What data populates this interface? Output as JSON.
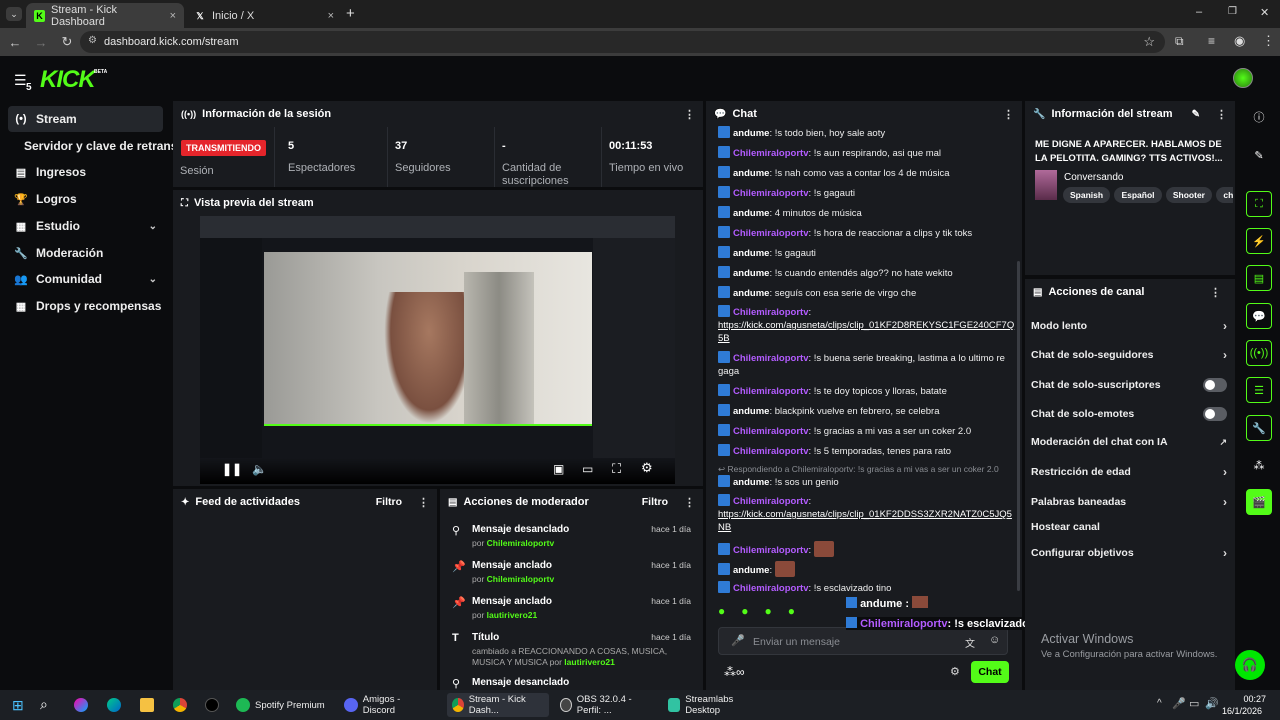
{
  "browser": {
    "tabs": [
      {
        "label": "Stream - Kick Dashboard",
        "close": "×"
      },
      {
        "label": "Inicio / X",
        "close": "×"
      }
    ],
    "new_tab": "+",
    "url": "dashboard.kick.com/stream",
    "window_controls": [
      "–",
      "❐",
      "✕"
    ]
  },
  "header": {
    "logo": "KICK",
    "logo_badge": "BETA",
    "count": "5"
  },
  "sidebar": {
    "items": [
      {
        "label": "Stream",
        "icon": "(•)"
      },
      {
        "label": "Servidor y clave de retransm"
      },
      {
        "label": "Ingresos",
        "icon": "▤"
      },
      {
        "label": "Logros",
        "icon": "🏆"
      },
      {
        "label": "Estudio",
        "icon": "▦",
        "chevron": "⌄"
      },
      {
        "label": "Moderación",
        "icon": "🔧"
      },
      {
        "label": "Comunidad",
        "icon": "👥",
        "chevron": "⌄"
      },
      {
        "label": "Drops y recompensas",
        "icon": "▦"
      }
    ]
  },
  "session": {
    "title": "Información de la sesión",
    "live_badge": "TRANSMITIENDO",
    "session_label": "Sesión",
    "stats": [
      {
        "value": "5",
        "label": "Espectadores"
      },
      {
        "value": "37",
        "label": "Seguidores"
      },
      {
        "value": "-",
        "label": "Cantidad de suscripciones"
      },
      {
        "value": "00:11:53",
        "label": "Tiempo en vivo"
      }
    ]
  },
  "preview": {
    "title": "Vista previa del stream"
  },
  "activity": {
    "title": "Feed de actividades",
    "filter": "Filtro"
  },
  "mod_actions": {
    "title": "Acciones de moderador",
    "filter": "Filtro",
    "rows": [
      {
        "title": "Mensaje desanclado",
        "by": "por",
        "user": "Chilemiraloportv",
        "time": "hace 1 día"
      },
      {
        "title": "Mensaje anclado",
        "by": "por",
        "user": "Chilemiraloportv",
        "time": "hace 1 día"
      },
      {
        "title": "Mensaje anclado",
        "by": "por",
        "user": "lautirivero21",
        "time": "hace 1 día"
      },
      {
        "title": "Título",
        "sub": "cambiado a REACCIONANDO A COSAS, MUSICA, MUSICA Y MUSICA por",
        "user": "lautirivero21",
        "time": "hace 1 día"
      },
      {
        "title": "Mensaje desanclado",
        "by": "",
        "user": "",
        "time": ""
      }
    ]
  },
  "chat": {
    "title": "Chat",
    "messages": [
      {
        "user": "andume",
        "text": "!s todo bien, hoy sale aoty",
        "c": "u1"
      },
      {
        "user": "Chilemiraloportv",
        "text": "!s aun respirando, asi que mal",
        "c": "u2"
      },
      {
        "user": "andume",
        "text": "!s nah como vas a contar los 4 de música",
        "c": "u1"
      },
      {
        "user": "Chilemiraloportv",
        "text": "!s gagauti",
        "c": "u2"
      },
      {
        "user": "andume",
        "text": "4 minutos de música",
        "c": "u1"
      },
      {
        "user": "Chilemiraloportv",
        "text": "!s hora de reaccionar a clips y tik toks",
        "c": "u2"
      },
      {
        "user": "andume",
        "text": "!s gagauti",
        "c": "u1"
      },
      {
        "user": "andume",
        "text": "!s cuando entendés algo?? no hate wekito",
        "c": "u1"
      },
      {
        "user": "andume",
        "text": "seguís con esa serie de virgo che",
        "c": "u1"
      },
      {
        "user": "Chilemiraloportv",
        "text": "",
        "link": "https://kick.com/agusneta/clips/clip_01KF2D8REKYSC1FGE240CF7Q5B",
        "c": "u2"
      },
      {
        "user": "Chilemiraloportv",
        "text": "!s buena serie breaking, lastima a lo ultimo re gaga",
        "c": "u2"
      },
      {
        "user": "Chilemiraloportv",
        "text": "!s te doy topicos y lloras, batate",
        "c": "u2"
      },
      {
        "user": "andume",
        "text": "blackpink vuelve en febrero, se celebra",
        "c": "u1"
      },
      {
        "user": "Chilemiraloportv",
        "text": "!s gracias a mi vas a ser un coker 2.0",
        "c": "u2"
      },
      {
        "user": "Chilemiraloportv",
        "text": "!s 5 temporadas, tenes para rato",
        "c": "u2"
      },
      {
        "reply": "Respondiendo a Chilemiraloportv: !s gracias a mi vas a ser un coker 2.0"
      },
      {
        "user": "andume",
        "text": "!s sos un genio",
        "c": "u1"
      },
      {
        "user": "Chilemiraloportv",
        "text": "",
        "link": "https://kick.com/agusneta/clips/clip_01KF2DDSS3ZXR2NATZ0C5JQ5NB",
        "c": "u2"
      },
      {
        "user": "Chilemiraloportv",
        "text": "",
        "emote": true,
        "c": "u2"
      },
      {
        "user": "andume",
        "text": "",
        "emote": true,
        "c": "u1"
      },
      {
        "user": "Chilemiraloportv",
        "text": "!s esclavizado tino",
        "c": "u2"
      }
    ],
    "input_placeholder": "Enviar un mensaje",
    "send_label": "Chat",
    "overlay": [
      {
        "user": "andume",
        "text": ":"
      },
      {
        "user": "Chilemiraloportv",
        "text": ": !s esclavizado tino"
      }
    ]
  },
  "stream_info": {
    "title": "Información del stream",
    "stream_title": "ME DIGNE A APARECER. HABLAMOS DE LA PELOTITA. GAMING? TTS ACTIVOS!...",
    "category": "Conversando",
    "tags": [
      "Spanish",
      "Español",
      "Shooter",
      "chill"
    ]
  },
  "channel_actions": {
    "title": "Acciones de canal",
    "items": [
      {
        "label": "Modo lento",
        "control": "chevron"
      },
      {
        "label": "Chat de solo-seguidores",
        "control": "chevron"
      },
      {
        "label": "Chat de solo-suscriptores",
        "control": "toggle"
      },
      {
        "label": "Chat de solo-emotes",
        "control": "toggle"
      },
      {
        "label": "Moderación del chat con IA",
        "control": "external"
      },
      {
        "label": "Restricción de edad",
        "control": "chevron"
      },
      {
        "label": "Palabras baneadas",
        "control": "chevron"
      },
      {
        "label": "Hostear canal",
        "control": "none"
      },
      {
        "label": "Configurar objetivos",
        "control": "chevron"
      }
    ]
  },
  "watermark": {
    "line1": "Activar Windows",
    "line2": "Ve a Configuración para activar Windows."
  },
  "taskbar": {
    "apps": [
      {
        "label": "Spotify Premium",
        "color": "#1db954"
      },
      {
        "label": "Amigos - Discord",
        "color": "#5865f2"
      },
      {
        "label": "Stream - Kick Dash...",
        "color": "#53fc18"
      },
      {
        "label": "OBS 32.0.4 - Perfil: ...",
        "color": "#444"
      },
      {
        "label": "Streamlabs Desktop",
        "color": "#31c3a2"
      }
    ],
    "time": "00:27",
    "date": "16/1/2026"
  }
}
